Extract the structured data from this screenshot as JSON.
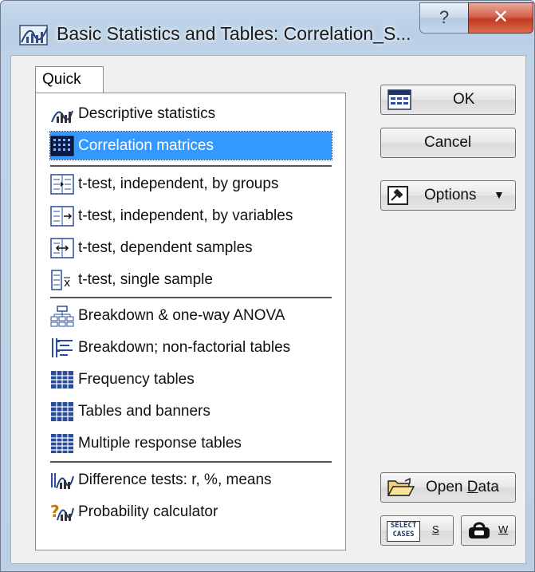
{
  "window": {
    "title": "Basic Statistics and Tables: Correlation_S...",
    "help_label": "?",
    "close_label": "✕"
  },
  "tabs": [
    {
      "label": "Quick"
    }
  ],
  "list": {
    "items": [
      {
        "label": "Descriptive statistics",
        "icon": "descriptive-stats-icon",
        "selected": false
      },
      {
        "label": "Correlation matrices",
        "icon": "correlation-matrix-icon",
        "selected": true
      },
      {
        "label": "t-test, independent, by groups",
        "icon": "ttest-groups-icon",
        "selected": false
      },
      {
        "label": "t-test, independent, by variables",
        "icon": "ttest-variables-icon",
        "selected": false
      },
      {
        "label": "t-test, dependent samples",
        "icon": "ttest-dependent-icon",
        "selected": false
      },
      {
        "label": "t-test, single sample",
        "icon": "ttest-single-icon",
        "selected": false
      },
      {
        "label": "Breakdown & one-way ANOVA",
        "icon": "breakdown-anova-icon",
        "selected": false
      },
      {
        "label": "Breakdown; non-factorial tables",
        "icon": "breakdown-nonfactorial-icon",
        "selected": false
      },
      {
        "label": "Frequency tables",
        "icon": "frequency-tables-icon",
        "selected": false
      },
      {
        "label": "Tables and banners",
        "icon": "tables-banners-icon",
        "selected": false
      },
      {
        "label": "Multiple response tables",
        "icon": "multiple-response-icon",
        "selected": false
      },
      {
        "label": "Difference tests: r, %, means",
        "icon": "difference-tests-icon",
        "selected": false
      },
      {
        "label": "Probability calculator",
        "icon": "probability-calculator-icon",
        "selected": false
      }
    ]
  },
  "buttons": {
    "ok_label": "OK",
    "cancel_label": "Cancel",
    "options_label": "Options",
    "options_arrow": "▼",
    "open_data_prefix": "Open ",
    "open_data_underlined": "D",
    "open_data_suffix": "ata",
    "select_cases_top": "SELECT",
    "select_cases_bottom": "CASES",
    "select_cases_key": "S",
    "weight_key": "W"
  },
  "colors": {
    "selection": "#3399ff",
    "title_gradient_top": "#c6d9ec",
    "close_red": "#c23b22"
  }
}
